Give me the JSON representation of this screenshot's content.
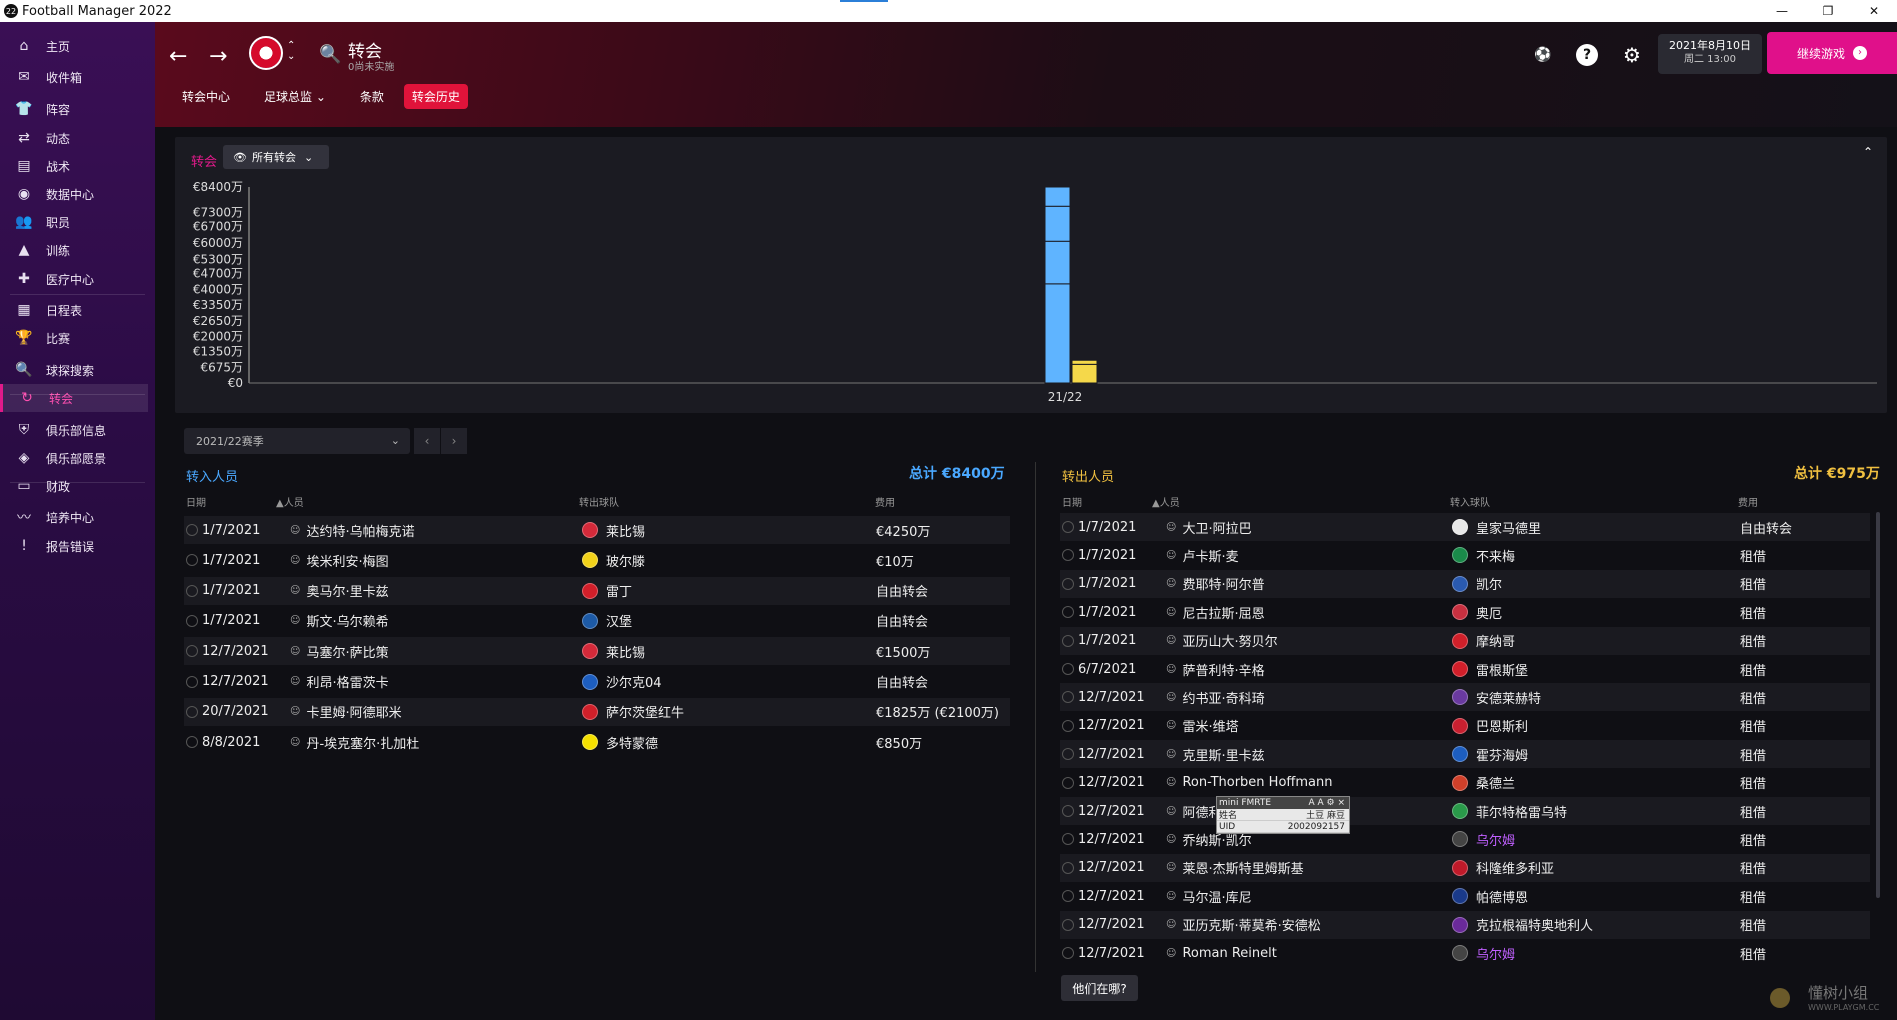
{
  "window": {
    "title": "Football Manager 2022",
    "app_badge": "22",
    "buttons": [
      "—",
      "❐",
      "✕"
    ]
  },
  "sidebar": {
    "items": [
      {
        "label": "主页",
        "icon": "home-icon",
        "glyph": "⌂"
      },
      {
        "label": "收件箱",
        "icon": "inbox-icon",
        "glyph": "✉"
      },
      {
        "label": "阵容",
        "icon": "shirt-icon",
        "glyph": "👕"
      },
      {
        "label": "动态",
        "icon": "dynamics-icon",
        "glyph": "⇄"
      },
      {
        "label": "战术",
        "icon": "tactics-icon",
        "glyph": "▤"
      },
      {
        "label": "数据中心",
        "icon": "data-hub-icon",
        "glyph": "◉"
      },
      {
        "label": "职员",
        "icon": "staff-icon",
        "glyph": "👥"
      },
      {
        "label": "训练",
        "icon": "training-icon",
        "glyph": "▲"
      },
      {
        "label": "医疗中心",
        "icon": "medical-icon",
        "glyph": "✚"
      },
      {
        "label": "日程表",
        "icon": "schedule-icon",
        "glyph": "▦"
      },
      {
        "label": "比赛",
        "icon": "trophy-icon",
        "glyph": "🏆"
      },
      {
        "label": "球探搜索",
        "icon": "scouting-icon",
        "glyph": "🔍"
      },
      {
        "label": "转会",
        "icon": "transfers-icon",
        "glyph": "↻"
      },
      {
        "label": "俱乐部信息",
        "icon": "club-info-icon",
        "glyph": "⛨"
      },
      {
        "label": "俱乐部愿景",
        "icon": "club-vision-icon",
        "glyph": "◈"
      },
      {
        "label": "财政",
        "icon": "finances-icon",
        "glyph": "▭"
      },
      {
        "label": "培养中心",
        "icon": "development-icon",
        "glyph": "〰"
      },
      {
        "label": "报告错误",
        "icon": "report-bug-icon",
        "glyph": "!"
      }
    ],
    "active_index": 12
  },
  "header": {
    "title": "转会",
    "subtitle": "0尚未实施",
    "date_line1": "2021年8月10日",
    "date_line2": "周二 13:00",
    "continue_label": "继续游戏",
    "tabs": [
      {
        "label": "转会中心"
      },
      {
        "label": "足球总监 ⌄"
      },
      {
        "label": "条款"
      },
      {
        "label": "转会历史"
      }
    ],
    "active_tab": 3
  },
  "chart_panel": {
    "label": "转会",
    "filter_label": "所有转会"
  },
  "chart_data": {
    "type": "bar",
    "categories": [
      "21/22"
    ],
    "ylim": [
      0,
      8400
    ],
    "y_ticks": [
      "€8400万",
      "€7300万",
      "€6700万",
      "€6000万",
      "€5300万",
      "€4700万",
      "€4000万",
      "€3350万",
      "€2650万",
      "€2000万",
      "€1350万",
      "€675万",
      "€0"
    ],
    "y_tick_values": [
      8400,
      7300,
      6700,
      6000,
      5300,
      4700,
      4000,
      3350,
      2650,
      2000,
      1350,
      675,
      0
    ],
    "series": [
      {
        "color": "#5fb4ff",
        "segments": [
          4250,
          1825,
          1500,
          825
        ]
      },
      {
        "color": "#f5d84a",
        "segments": [
          800,
          175
        ]
      }
    ]
  },
  "season_select": {
    "value": "2021/22赛季"
  },
  "transfers_in": {
    "title": "转入人员",
    "total": "总计 €8400万",
    "headers": {
      "date": "日期",
      "person": "▲人员",
      "club": "转出球队",
      "fee": "费用"
    },
    "rows": [
      {
        "date": "1/7/2021",
        "player": "达约特·乌帕梅克诺",
        "club": "莱比锡",
        "fee": "€4250万",
        "crest": "#d42a3a"
      },
      {
        "date": "1/7/2021",
        "player": "埃米利安·梅图",
        "club": "玻尔滕",
        "fee": "€10万",
        "crest": "#f2d21a"
      },
      {
        "date": "1/7/2021",
        "player": "奥马尔·里卡兹",
        "club": "雷丁",
        "fee": "自由转会",
        "crest": "#d21f2a"
      },
      {
        "date": "1/7/2021",
        "player": "斯文·乌尔赖希",
        "club": "汉堡",
        "fee": "自由转会",
        "crest": "#1d5aa6"
      },
      {
        "date": "12/7/2021",
        "player": "马塞尔·萨比策",
        "club": "莱比锡",
        "fee": "€1500万",
        "crest": "#d42a3a"
      },
      {
        "date": "12/7/2021",
        "player": "利昂·格雷茨卡",
        "club": "沙尔克04",
        "fee": "自由转会",
        "crest": "#1d5ec0"
      },
      {
        "date": "20/7/2021",
        "player": "卡里姆·阿德耶米",
        "club": "萨尔茨堡红牛",
        "fee": "€1825万 (€2100万)",
        "crest": "#d0202a"
      },
      {
        "date": "8/8/2021",
        "player": "丹-埃克塞尔·扎加杜",
        "club": "多特蒙德",
        "fee": "€850万",
        "crest": "#f5e000"
      }
    ]
  },
  "transfers_out": {
    "title": "转出人员",
    "total": "总计 €975万",
    "headers": {
      "date": "日期",
      "person": "▲人员",
      "club": "转入球队",
      "fee": "费用"
    },
    "rows": [
      {
        "date": "1/7/2021",
        "player": "大卫·阿拉巴",
        "club": "皇家马德里",
        "fee": "自由转会",
        "crest": "#e8e8e8",
        "purple": false
      },
      {
        "date": "1/7/2021",
        "player": "卢卡斯·麦",
        "club": "不来梅",
        "fee": "租借",
        "crest": "#1a8a4a",
        "purple": false
      },
      {
        "date": "1/7/2021",
        "player": "费耶特·阿尔普",
        "club": "凯尔",
        "fee": "租借",
        "crest": "#2a5ab0",
        "purple": false
      },
      {
        "date": "1/7/2021",
        "player": "尼古拉斯·屈恩",
        "club": "奥厄",
        "fee": "租借",
        "crest": "#c83040",
        "purple": false
      },
      {
        "date": "1/7/2021",
        "player": "亚历山大·努贝尔",
        "club": "摩纳哥",
        "fee": "租借",
        "crest": "#d0202a",
        "purple": false
      },
      {
        "date": "6/7/2021",
        "player": "萨普利特·辛格",
        "club": "雷根斯堡",
        "fee": "租借",
        "crest": "#d21f2a",
        "purple": false
      },
      {
        "date": "12/7/2021",
        "player": "约书亚·奇科琦",
        "club": "安德莱赫特",
        "fee": "租借",
        "crest": "#6a3aa0",
        "purple": false
      },
      {
        "date": "12/7/2021",
        "player": "雷米·维塔",
        "club": "巴恩斯利",
        "fee": "租借",
        "crest": "#c82030",
        "purple": false
      },
      {
        "date": "12/7/2021",
        "player": "克里斯·里卡兹",
        "club": "霍芬海姆",
        "fee": "租借",
        "crest": "#1d5ec0",
        "purple": false
      },
      {
        "date": "12/7/2021",
        "player": "Ron-Thorben Hoffmann",
        "club": "桑德兰",
        "fee": "租借",
        "crest": "#d0402a",
        "purple": false
      },
      {
        "date": "12/7/2021",
        "player": "阿德利·延塞",
        "club": "菲尔特格雷乌特",
        "fee": "租借",
        "crest": "#2a9a4a",
        "purple": false
      },
      {
        "date": "12/7/2021",
        "player": "乔纳斯·凯尔",
        "club": "乌尔姆",
        "fee": "租借",
        "crest": "#444444",
        "purple": true
      },
      {
        "date": "12/7/2021",
        "player": "莱恩·杰斯特里姆斯基",
        "club": "科隆维多利亚",
        "fee": "租借",
        "crest": "#c01a2a",
        "purple": false
      },
      {
        "date": "12/7/2021",
        "player": "马尔温·库尼",
        "club": "帕德博恩",
        "fee": "租借",
        "crest": "#1a3a8a",
        "purple": false
      },
      {
        "date": "12/7/2021",
        "player": "亚历克斯·蒂莫希·安德松",
        "club": "克拉根福特奥地利人",
        "fee": "租借",
        "crest": "#6a2a9a",
        "purple": false
      },
      {
        "date": "12/7/2021",
        "player": "Roman Reinelt",
        "club": "乌尔姆",
        "fee": "租借",
        "crest": "#444444",
        "purple": true
      }
    ]
  },
  "where_button": "他们在哪?",
  "mini_tooltip": {
    "title": "mini FMRTE",
    "controls": "A A ⚙ ×",
    "row1_label": "姓名",
    "row1_value": "土豆 麻豆",
    "row2_label": "UID",
    "row2_value": "2002092157"
  },
  "watermark": {
    "text": "懂树小组",
    "url": "WWW.PLAYGM.CC"
  }
}
